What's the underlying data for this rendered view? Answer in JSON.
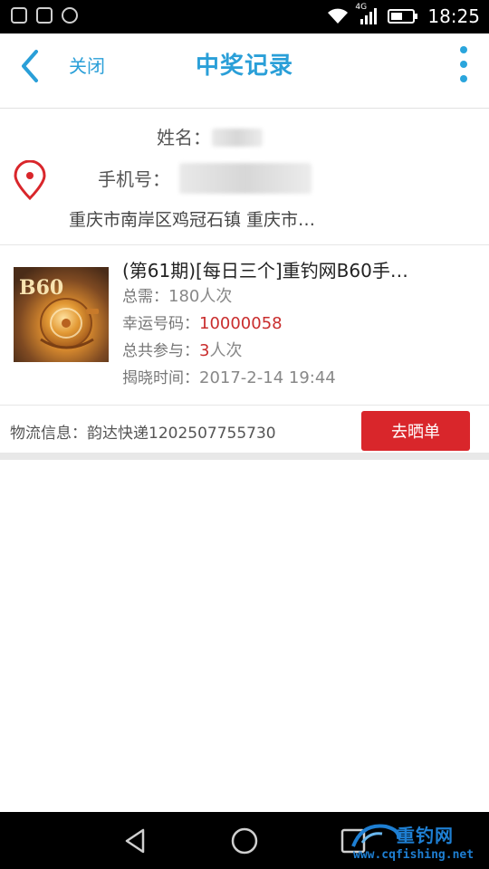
{
  "status_bar": {
    "time": "18:25",
    "network": "4G"
  },
  "header": {
    "close_label": "关闭",
    "title": "中奖记录"
  },
  "address": {
    "name_label": "姓名：",
    "phone_label": "手机号：",
    "address_text": "重庆市南岸区鸡冠石镇 重庆市…"
  },
  "product": {
    "title": "(第61期)[每日三个]重钓网B60手…",
    "total_label": "总需：",
    "total_value": "180人次",
    "lucky_label": "幸运号码：",
    "lucky_value": "10000058",
    "join_label": "总共参与：",
    "join_count": "3",
    "join_unit": "人次",
    "reveal_label": "揭晓时间：",
    "reveal_value": "2017-2-14 19:44",
    "thumb_text": "B60"
  },
  "logistics": {
    "text": "物流信息：韵达快递1202507755730",
    "share_button": "去晒单"
  },
  "watermark": {
    "brand": "重钓网",
    "url": "www.cqfishing.net"
  },
  "colors": {
    "accent": "#2a9fd8",
    "danger": "#d9262b",
    "lucky": "#c92d2d"
  }
}
